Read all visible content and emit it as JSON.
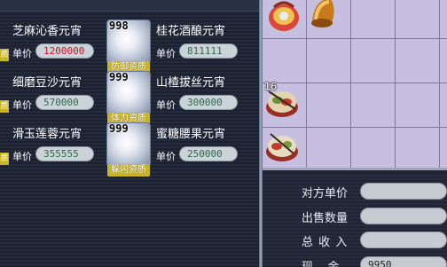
{
  "goods_list": {
    "price_label": "单价",
    "items": [
      {
        "name": "芝麻沁香元宵",
        "price": "1200000",
        "quantity": "",
        "tag": ""
      },
      {
        "name": "桂花酒酿元宵",
        "price": "811111",
        "quantity": "998",
        "tag": "防御资质"
      },
      {
        "name": "细磨豆沙元宵",
        "price": "570000",
        "quantity": "",
        "tag": ""
      },
      {
        "name": "山楂拔丝元宵",
        "price": "300000",
        "quantity": "999",
        "tag": "体力资质"
      },
      {
        "name": "滑玉莲蓉元宵",
        "price": "355555",
        "quantity": "",
        "tag": ""
      },
      {
        "name": "蜜糖腰果元宵",
        "price": "250000",
        "quantity": "999",
        "tag": "躲闪资质"
      }
    ],
    "left_edge_tags": [
      "质",
      "质",
      "质"
    ]
  },
  "inventory": {
    "items": [
      {
        "icon": "gift-bag-icon",
        "count": ""
      },
      {
        "icon": "bell-icon",
        "count": ""
      },
      {
        "icon": "food-bowl-icon",
        "count": "16"
      },
      {
        "icon": "food-bowl-icon",
        "count": ""
      }
    ]
  },
  "trade_info": {
    "rows": [
      {
        "label": "对方单价",
        "value": ""
      },
      {
        "label": "出售数量",
        "value": ""
      },
      {
        "label": "总 收 入",
        "value": ""
      },
      {
        "label": "现    金",
        "value": "9950"
      }
    ]
  },
  "colors": {
    "panel_bg": "#1e2330",
    "quality_tag": "#c8b428",
    "price_red": "#c0192b",
    "price_green": "#2f6b4f",
    "inventory_bg": "#c7bfdf"
  }
}
